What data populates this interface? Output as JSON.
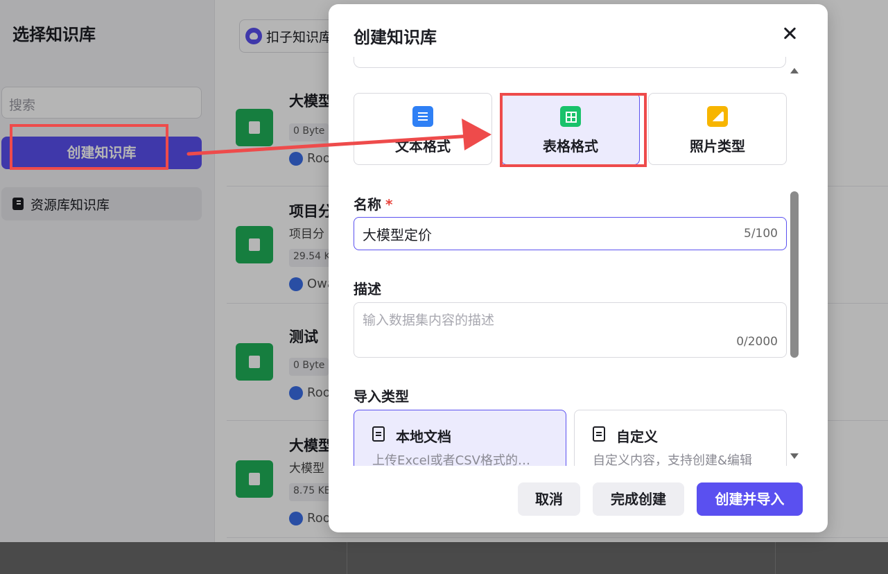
{
  "sidebar": {
    "title": "选择知识库",
    "search_placeholder": "搜索",
    "create_label": "创建知识库",
    "library_item": "资源库知识库"
  },
  "main": {
    "source_label": "扣子知识库",
    "items": [
      {
        "name": "大模型",
        "desc": "",
        "size": "0 Byte",
        "owner": "Roo"
      },
      {
        "name": "项目分",
        "desc": "项目分",
        "size": "29.54 K",
        "owner": "Owa"
      },
      {
        "name": "测试",
        "desc": "",
        "size": "0 Byte",
        "owner": "Roo"
      },
      {
        "name": "大模型",
        "desc": "大模型",
        "size": "8.75 KB",
        "owner": "Roo"
      }
    ]
  },
  "modal": {
    "title": "创建知识库",
    "types": [
      {
        "label": "文本格式",
        "icon": "document-icon",
        "color": "#2f80f5"
      },
      {
        "label": "表格格式",
        "icon": "table-icon",
        "color": "#19c26b",
        "selected": true
      },
      {
        "label": "照片类型",
        "icon": "image-icon",
        "color": "#f7b500"
      }
    ],
    "name_label": "名称",
    "required_mark": "*",
    "name_value": "大模型定价",
    "name_count": "5/100",
    "desc_label": "描述",
    "desc_placeholder": "输入数据集内容的描述",
    "desc_count": "0/2000",
    "import_label": "导入类型",
    "import_options": [
      {
        "title": "本地文档",
        "desc": "上传Excel或者CSV格式的…",
        "selected": true
      },
      {
        "title": "自定义",
        "desc": "自定义内容，支持创建&编辑"
      }
    ],
    "buttons": {
      "cancel": "取消",
      "done": "完成创建",
      "create_import": "创建并导入"
    }
  },
  "colors": {
    "accent": "#5a50f0",
    "annotation": "#ee4b4b"
  }
}
